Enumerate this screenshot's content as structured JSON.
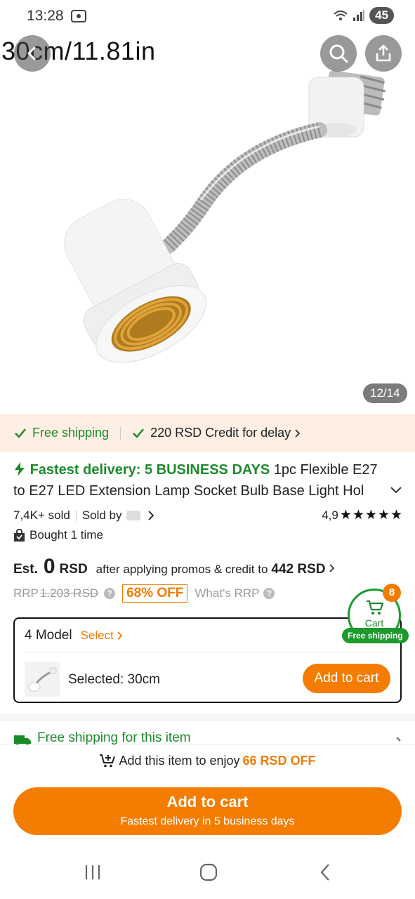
{
  "status_bar": {
    "time": "13:28",
    "battery": "45"
  },
  "gallery": {
    "caption": "30cm/11.81in",
    "counter": "12/14"
  },
  "shipping_banner": {
    "free_shipping": "Free shipping",
    "credit": "220 RSD Credit for delay"
  },
  "product": {
    "fast_delivery": "Fastest delivery: 5 BUSINESS DAYS",
    "title": "1pc Flexible E27 to E27 LED Extension Lamp Socket Bulb Base Light Hol",
    "sold": "7,4K+ sold",
    "sold_by": "Sold by",
    "rating": "4,9",
    "stars": "★★★★★",
    "bought": "Bought 1 time"
  },
  "price": {
    "est_label": "Est.",
    "amount": "0",
    "currency": "RSD",
    "after_text": "after applying promos & credit to",
    "after_amount": "442 RSD",
    "rrp_label": "RRP",
    "rrp_value": "1.203 RSD",
    "discount": "68% OFF",
    "whats_rrp": "What's RRP"
  },
  "floating_cart": {
    "label": "Cart",
    "count": "8",
    "badge": "Free shipping"
  },
  "model": {
    "count_label": "4 Model",
    "select_label": "Select",
    "selected_text": "Selected: 30cm",
    "add_button": "Add to cart"
  },
  "free_ship_item": "Free shipping for this item",
  "bottom": {
    "enjoy_prefix": "Add this item to enjoy",
    "enjoy_amount": "66 RSD OFF",
    "add_title": "Add to cart",
    "add_sub": "Fastest delivery in 5 business days"
  },
  "colors": {
    "accent_orange": "#f47c00",
    "green": "#1c8a2b",
    "banner_bg": "#fdefe3"
  }
}
